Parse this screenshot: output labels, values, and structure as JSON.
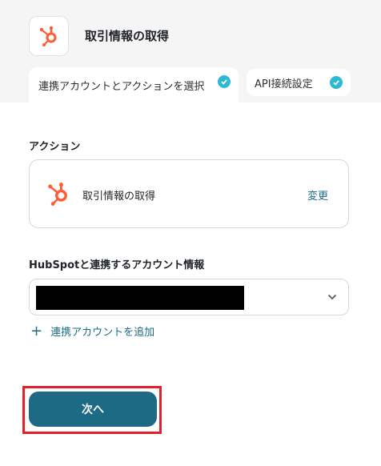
{
  "header": {
    "title": "取引情報の取得",
    "icon": "hubspot-icon"
  },
  "tabs": [
    {
      "label": "連携アカウントとアクションを選択",
      "status": "complete"
    },
    {
      "label": "API接続設定",
      "status": "complete"
    }
  ],
  "action_section": {
    "label": "アクション",
    "action_name": "取引情報の取得",
    "change_label": "変更"
  },
  "account_section": {
    "label": "HubSpotと連携するアカウント情報",
    "selected_value": "[REDACTED]",
    "add_account_label": "連携アカウントを追加"
  },
  "footer": {
    "next_label": "次へ"
  },
  "colors": {
    "hubspot_orange": "#ff5c35",
    "check_teal": "#2fb8d3",
    "primary_button": "#1c6a83",
    "link": "#1e6b86",
    "highlight_outline": "#e0202a"
  }
}
